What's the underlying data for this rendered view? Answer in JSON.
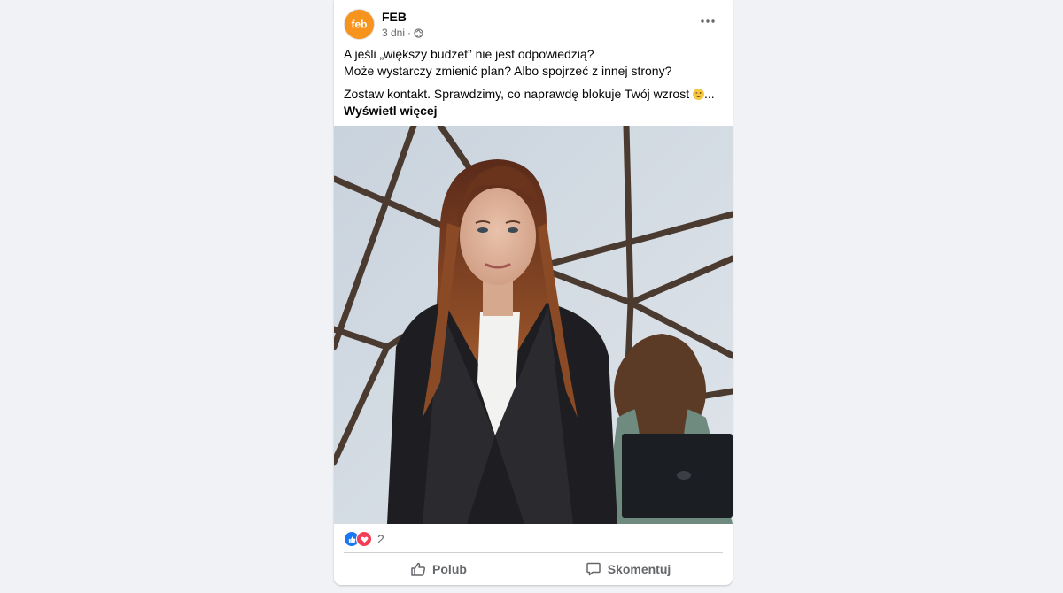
{
  "post": {
    "author": "FEB",
    "avatar_text": "feb",
    "time": "3 dni",
    "meta_separator": "·",
    "audience_icon": "globe-icon",
    "more_icon": "more-horizontal-icon",
    "lines": [
      "A jeśli „większy budżet” nie jest odpowiedzią?",
      "Może wystarczy zmienić plan? Albo spojrzeć z innej strony?"
    ],
    "cta": "Zostaw kontakt. Sprawdzimy, co naprawdę blokuje Twój wzrost",
    "ellipsis": "...",
    "see_more": "Wyświetl więcej",
    "brand_color": "#f7941d"
  },
  "reactions": {
    "icons": [
      "like-reaction-icon",
      "love-reaction-icon"
    ],
    "count": "2"
  },
  "actions": {
    "like": "Polub",
    "comment": "Skomentuj"
  }
}
